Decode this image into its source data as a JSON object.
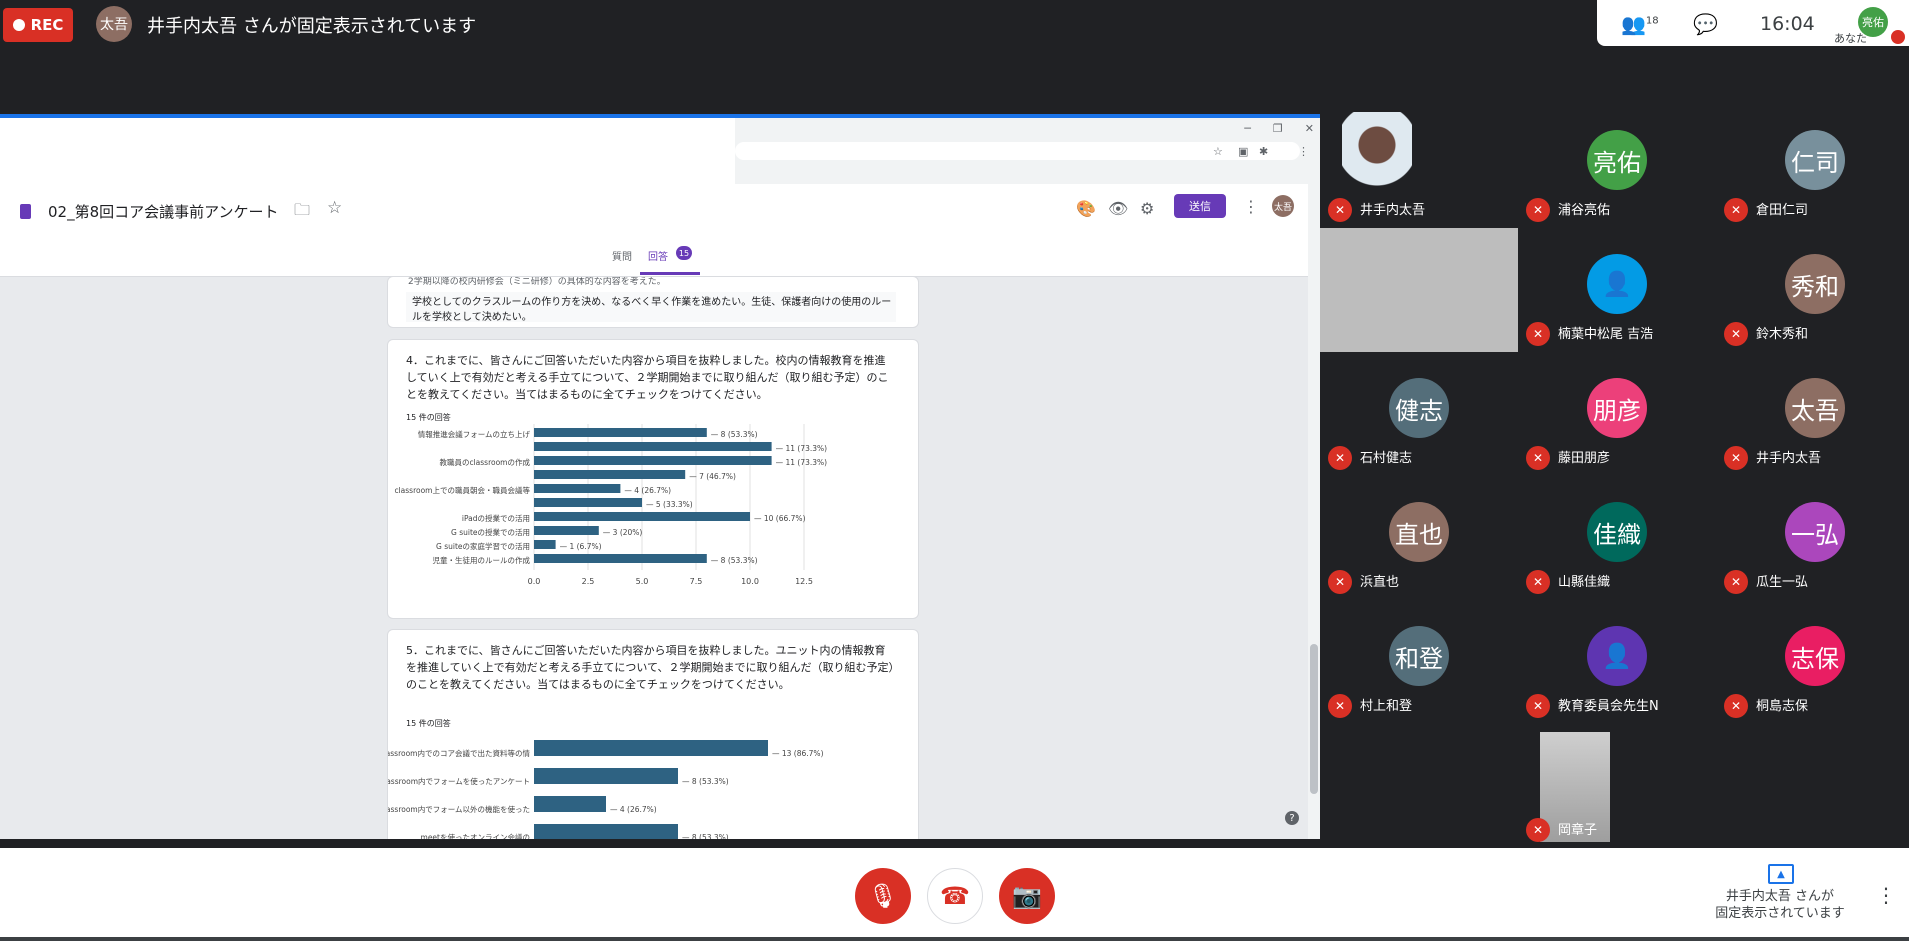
{
  "topbar": {
    "rec_label": "REC",
    "pinned_avatar": "太吾",
    "pinned_text": "井手内太吾 さんが固定表示されています",
    "participants_count": "18",
    "time": "16:04",
    "me_avatar": "亮佑",
    "me_label": "あなた"
  },
  "form": {
    "title": "02_第8回コア会議事前アンケート",
    "send_label": "送信",
    "header_avatar": "太吾",
    "tab_questions": "質問",
    "tab_responses": "回答",
    "responses_badge": "15",
    "prev_line": "2学期以降の校内研修会（ミニ研修）の具体的な内容を考えた。",
    "prev_answer": "学校としてのクラスルームの作り方を決め、なるべく早く作業を進めたい。生徒、保護者向けの使用のルールを学校として決めたい。",
    "q4": {
      "text": "4．これまでに、皆さんにご回答いただいた内容から項目を抜粋しました。校内の情報教育を推進していく上で有効だと考える手立てについて、２学期開始までに取り組んだ（取り組む予定）のことを教えてください。当てはまるものに全てチェックをつけてください。",
      "count": "15 件の回答"
    },
    "q5": {
      "text": "5．これまでに、皆さんにご回答いただいた内容から項目を抜粋しました。ユニット内の情報教育を推進していく上で有効だと考える手立てについて、２学期開始までに取り組んだ（取り組む予定）のことを教えてください。当てはまるものに全てチェックをつけてください。",
      "count": "15 件の回答"
    }
  },
  "chart_data": [
    {
      "type": "bar",
      "orientation": "horizontal",
      "color": "#2e6282",
      "categories": [
        "情報推進会議フォームの立ち上げ",
        "教職員のclassroomの作成",
        "",
        "classroom上での職員朝会・職員会議等の実施",
        "",
        "iPadの授業での活用",
        "G suiteの授業での活用",
        "G suiteの家庭学習での活用",
        "児童・生徒用のルールの作成"
      ],
      "values": [
        8,
        11,
        11,
        7,
        4,
        5,
        10,
        3,
        1,
        8
      ],
      "rows": [
        {
          "label": "情報推進会議フォームの立ち上げ",
          "value": 8,
          "data_label": "8 (53.3%)"
        },
        {
          "label": "",
          "value": 11,
          "data_label": "11 (73.3%)"
        },
        {
          "label": "教職員のclassroomの作成",
          "value": 11,
          "data_label": "11 (73.3%)"
        },
        {
          "label": "",
          "value": 7,
          "data_label": "7 (46.7%)"
        },
        {
          "label": "classroom上での職員朝会・職員会議等の実施",
          "value": 4,
          "data_label": "4 (26.7%)"
        },
        {
          "label": "",
          "value": 5,
          "data_label": "5 (33.3%)"
        },
        {
          "label": "iPadの授業での活用",
          "value": 10,
          "data_label": "10 (66.7%)"
        },
        {
          "label": "G suiteの授業での活用",
          "value": 3,
          "data_label": "3 (20%)"
        },
        {
          "label": "G suiteの家庭学習での活用",
          "value": 1,
          "data_label": "1 (6.7%)"
        },
        {
          "label": "児童・生徒用のルールの作成",
          "value": 8,
          "data_label": "8 (53.3%)"
        }
      ],
      "xticks": [
        "0.0",
        "2.5",
        "5.0",
        "7.5",
        "10.0",
        "12.5"
      ],
      "xlim": [
        0,
        12.5
      ],
      "grid": true
    },
    {
      "type": "bar",
      "orientation": "horizontal",
      "color": "#2e6282",
      "rows": [
        {
          "label": "classroom内でのコア会議で出た資料等の情報共有",
          "value": 13,
          "data_label": "13 (86.7%)"
        },
        {
          "label": "classroom内でフォームを使ったアンケートの実施",
          "value": 8,
          "data_label": "8 (53.3%)"
        },
        {
          "label": "classroom内でフォーム以外の機能を使った課題の提示・回収",
          "value": 4,
          "data_label": "4 (26.7%)"
        },
        {
          "label": "meetを使ったオンライン会議の",
          "value": 8,
          "data_label": "8 (53.3%)"
        }
      ],
      "xlim": [
        0,
        15
      ],
      "grid": true
    }
  ],
  "tiles": [
    {
      "name": "井手内太吾",
      "kind": "video"
    },
    {
      "name": "浦谷亮佑",
      "avatar": "亮佑",
      "color": "#43a047"
    },
    {
      "name": "倉田仁司",
      "avatar": "仁司",
      "color": "#78909c"
    },
    {
      "name": "",
      "kind": "blank"
    },
    {
      "name": "楠葉中松尾 吉浩",
      "avatar": "",
      "color": "#039be5",
      "kind": "person"
    },
    {
      "name": "鈴木秀和",
      "avatar": "秀和",
      "color": "#8d6e63"
    },
    {
      "name": "石村健志",
      "avatar": "健志",
      "color": "#546e7a"
    },
    {
      "name": "藤田朋彦",
      "avatar": "朋彦",
      "color": "#ec407a"
    },
    {
      "name": "井手内太吾",
      "avatar": "太吾",
      "color": "#8d6e63"
    },
    {
      "name": "浜直也",
      "avatar": "直也",
      "color": "#8d6e63"
    },
    {
      "name": "山縣佳織",
      "avatar": "佳織",
      "color": "#00695c"
    },
    {
      "name": "瓜生一弘",
      "avatar": "一弘",
      "color": "#ab47bc"
    },
    {
      "name": "村上和登",
      "avatar": "和登",
      "color": "#546e7a"
    },
    {
      "name": "教育委員会先生N",
      "avatar": "",
      "color": "#5e35b1",
      "kind": "person"
    },
    {
      "name": "桐島志保",
      "avatar": "志保",
      "color": "#e91e63"
    },
    {
      "name": "岡章子",
      "kind": "video2"
    }
  ],
  "bottombar": {
    "present_line1": "井手内太吾 さんが",
    "present_line2": "固定表示されています"
  }
}
